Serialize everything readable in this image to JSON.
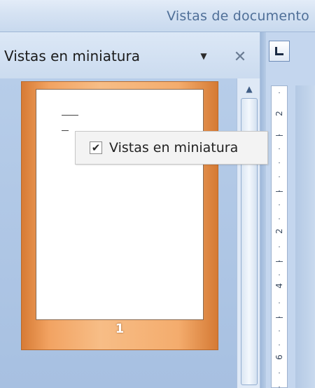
{
  "ribbon": {
    "group_label": "Vistas de documento"
  },
  "pane": {
    "view_label": "Vistas en miniatura",
    "dropdown_icon": "chevron-down-icon",
    "close_icon": "close-icon"
  },
  "thumbnails": {
    "pages": [
      {
        "number": "1",
        "selected": true
      }
    ]
  },
  "popup": {
    "label": "Vistas en miniatura",
    "checked": true,
    "check_glyph": "✔"
  },
  "ruler": {
    "tab_selector_icon": "left-tab-icon",
    "numbers": [
      "2",
      "2",
      "4",
      "6"
    ]
  },
  "colors": {
    "selected_thumb": "#f2a362",
    "pane_background": "#b7cde9",
    "ribbon_text": "#4f6f98"
  }
}
